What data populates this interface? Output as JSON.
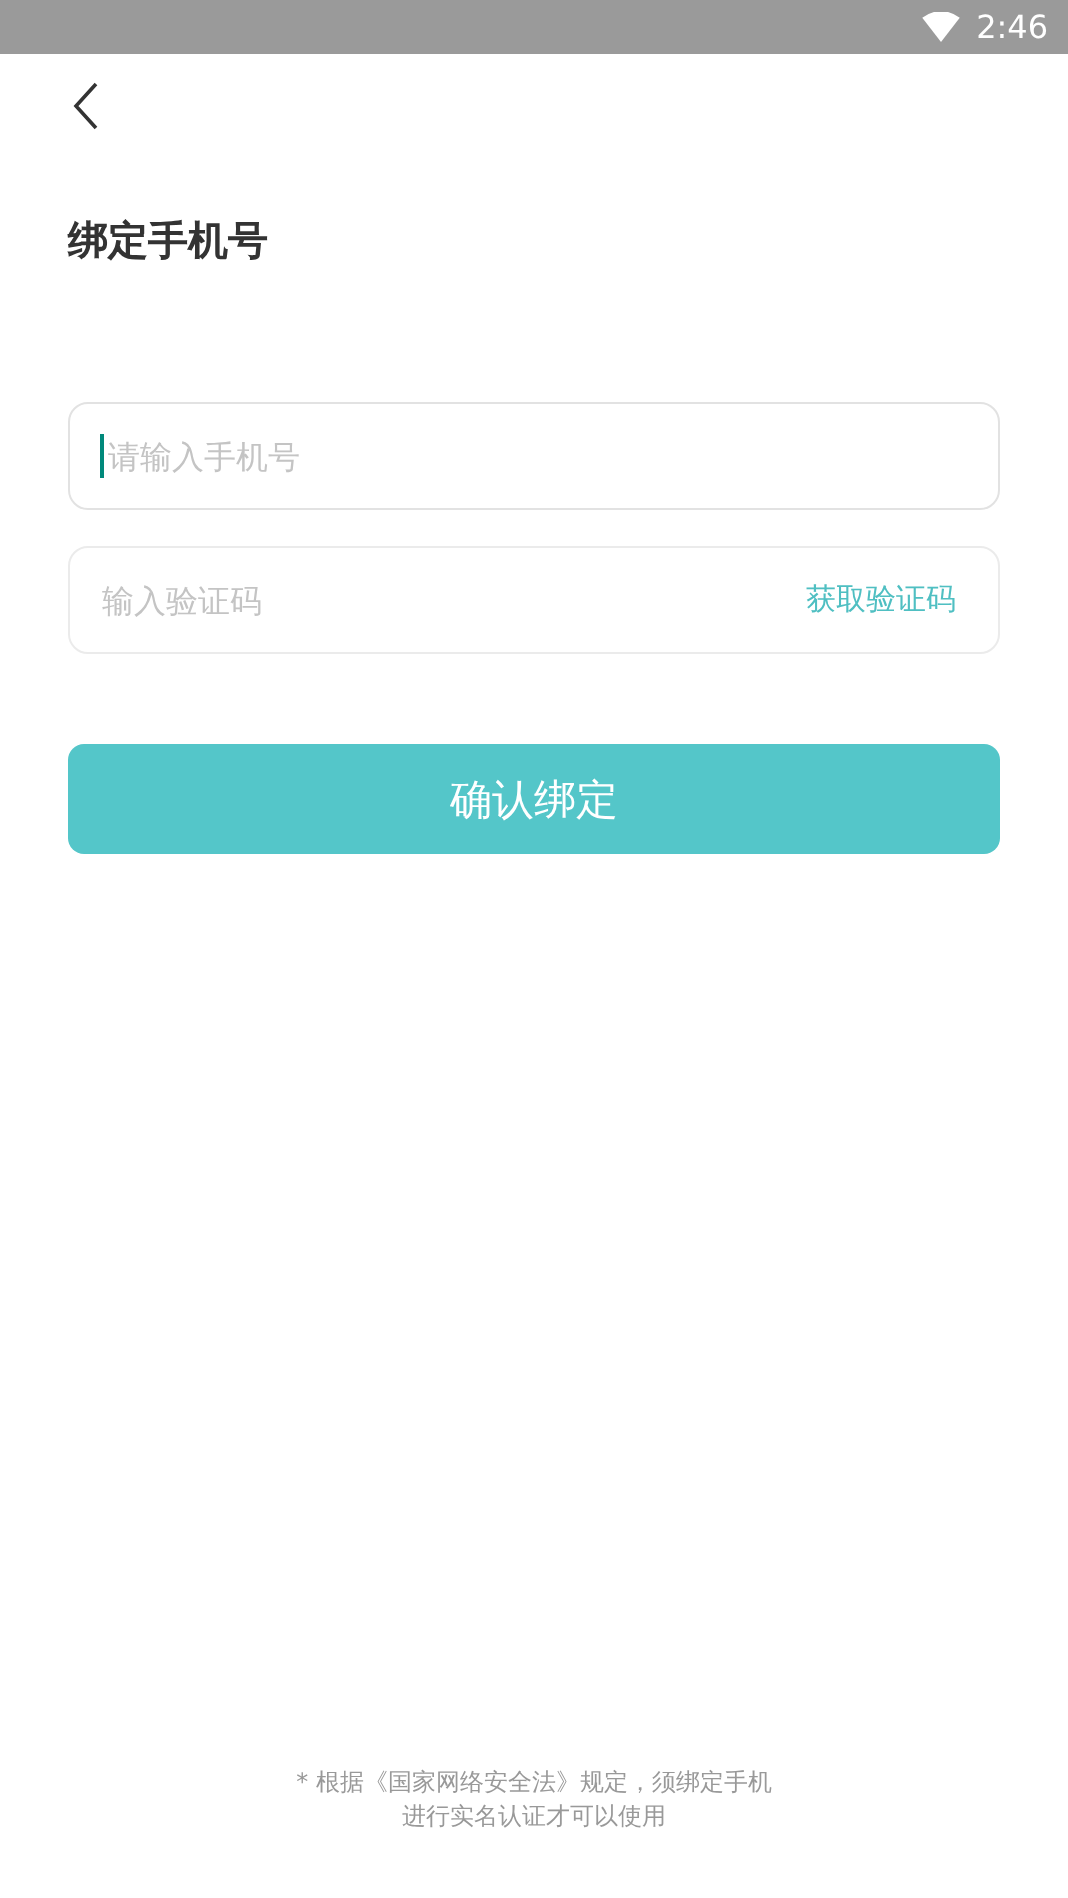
{
  "status_bar": {
    "time": "2:46"
  },
  "title": "绑定手机号",
  "phone_field": {
    "placeholder": "请输入手机号",
    "focused": true
  },
  "code_field": {
    "placeholder": "输入验证码",
    "focused": false,
    "action": "获取验证码"
  },
  "confirm_button": "确认绑定",
  "notice": [
    "* 根据《国家网络安全法》规定，须绑定手机",
    "进行实名认证才可以使用"
  ]
}
